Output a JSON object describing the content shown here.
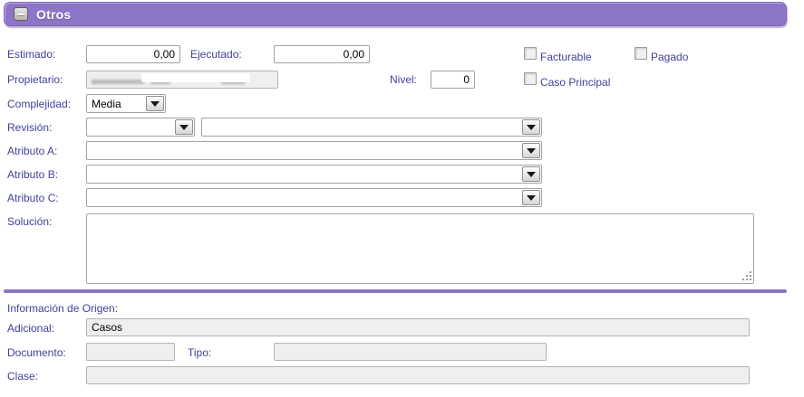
{
  "header": {
    "title": "Otros"
  },
  "colors": {
    "accent": "#8c75c7",
    "label": "#41419c",
    "readonly_bg": "#efefef"
  },
  "fields": {
    "estimado": {
      "label": "Estimado:",
      "value": "0,00"
    },
    "ejecutado": {
      "label": "Ejecutado:",
      "value": "0,00"
    },
    "facturable": {
      "label": "Facturable",
      "checked": false
    },
    "pagado": {
      "label": "Pagado",
      "checked": false
    },
    "propietario": {
      "label": "Propietario:",
      "value": "",
      "redacted": true
    },
    "nivel": {
      "label": "Nivel:",
      "value": "0"
    },
    "caso_principal": {
      "label": "Caso Principal",
      "checked": false
    },
    "complejidad": {
      "label": "Complejidad:",
      "value": "Media"
    },
    "revision": {
      "label": "Revisión:",
      "value": "",
      "value2": ""
    },
    "atributo_a": {
      "label": "Atributo A:",
      "value": ""
    },
    "atributo_b": {
      "label": "Atributo B:",
      "value": ""
    },
    "atributo_c": {
      "label": "Atributo C:",
      "value": ""
    },
    "solucion": {
      "label": "Solución:",
      "value": ""
    }
  },
  "origen": {
    "section_label": "Información de Origen:",
    "adicional": {
      "label": "Adicional:",
      "value": "Casos"
    },
    "documento": {
      "label": "Documento:",
      "value": ""
    },
    "tipo": {
      "label": "Tipo:",
      "value": ""
    },
    "clase": {
      "label": "Clase:",
      "value": ""
    }
  }
}
